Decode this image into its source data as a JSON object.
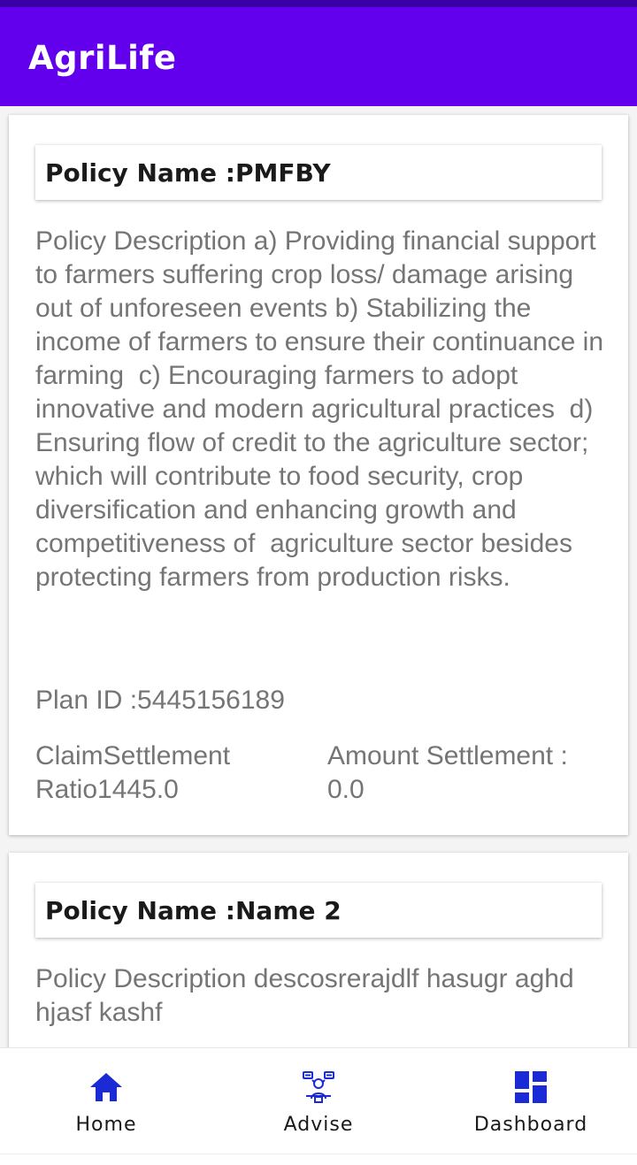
{
  "app": {
    "title": "AgriLife"
  },
  "policies": [
    {
      "name": "Policy Name :PMFBY",
      "description": "Policy Description a) Providing financial support to farmers suffering crop loss/ damage arising out of unforeseen events b) Stabilizing the income of farmers to ensure their continuance in farming  c) Encouraging farmers to adopt innovative and modern agricultural practices  d) Ensuring flow of credit to the agriculture sector; which will contribute to food security, crop diversification and enhancing growth and competitiveness of  agriculture sector besides protecting farmers from production risks.",
      "plan_id": "Plan ID :5445156189",
      "claim_settlement": "ClaimSettlement Ratio1445.0",
      "amount_settlement": "Amount Settlement : 0.0"
    },
    {
      "name": "Policy Name :Name 2",
      "description": "Policy Description descosrerajdlf hasugr aghd hjasf kashf"
    }
  ],
  "bottom_nav": {
    "items": [
      {
        "label": "Home",
        "icon": "home-icon",
        "active": true
      },
      {
        "label": "Advise",
        "icon": "advise-icon"
      },
      {
        "label": "Dashboard",
        "icon": "dashboard-icon"
      }
    ],
    "icon_color": "#1a2bd6"
  },
  "colors": {
    "app_bar": "#6200ee",
    "status_strip": "#3a00a8",
    "body_text": "#757575"
  }
}
